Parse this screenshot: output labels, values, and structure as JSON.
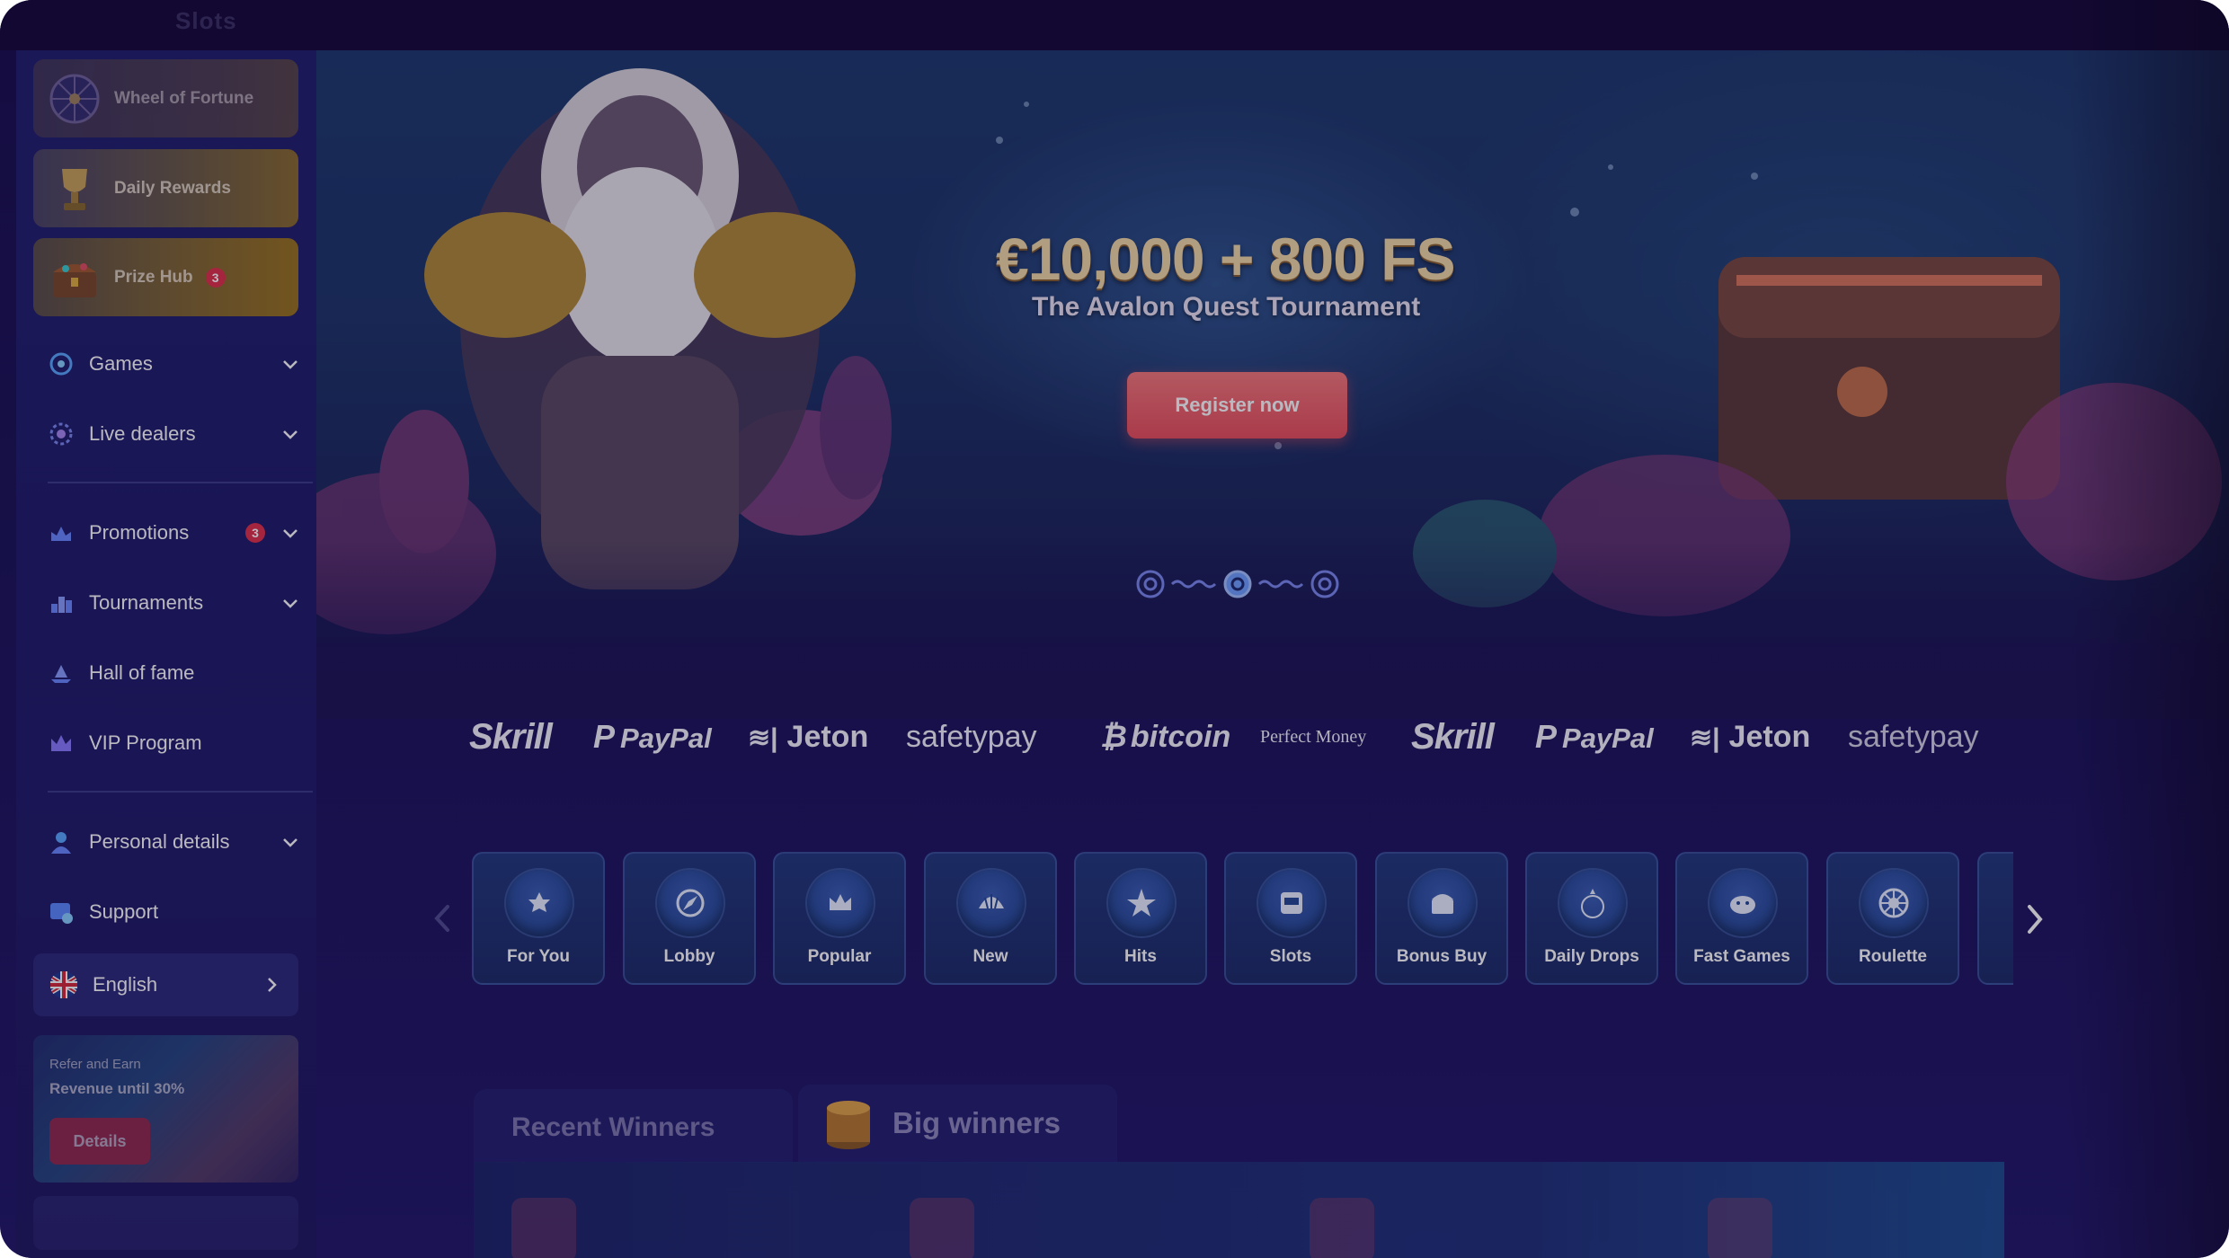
{
  "topbar": {
    "logo_text": "Slots"
  },
  "sidebar": {
    "promo_tiles": [
      {
        "label": "Wheel of Fortune",
        "icon": "wheel-icon"
      },
      {
        "label": "Daily Rewards",
        "icon": "trophy-icon"
      },
      {
        "label": "Prize Hub",
        "icon": "treasure-chest-icon",
        "badge": "3"
      }
    ],
    "nav": [
      {
        "label": "Games",
        "icon": "games-icon",
        "expandable": true
      },
      {
        "label": "Live dealers",
        "icon": "live-dealers-icon",
        "expandable": true
      },
      {
        "label": "Promotions",
        "icon": "promotions-icon",
        "expandable": true,
        "badge": "3"
      },
      {
        "label": "Tournaments",
        "icon": "tournaments-icon",
        "expandable": true
      },
      {
        "label": "Hall of fame",
        "icon": "hall-of-fame-icon",
        "expandable": false
      },
      {
        "label": "VIP Program",
        "icon": "crown-icon",
        "expandable": false
      },
      {
        "label": "Personal details",
        "icon": "user-icon",
        "expandable": true
      },
      {
        "label": "Support",
        "icon": "support-icon",
        "expandable": false
      }
    ],
    "language": {
      "label": "English",
      "icon": "uk-flag-icon"
    },
    "refer": {
      "small": "Refer and Earn",
      "big": "Revenue until 30%",
      "button": "Details"
    }
  },
  "hero": {
    "title": "€10,000 + 800 FS",
    "subtitle": "The Avalon Quest Tournament",
    "cta": "Register now"
  },
  "payments": [
    {
      "label": "Skrill",
      "style": "skrill"
    },
    {
      "label": "PayPal",
      "style": "paypal"
    },
    {
      "label": "Jeton",
      "style": "jeton"
    },
    {
      "label": "safetypay",
      "style": "safetypay"
    },
    {
      "label": "bitcoin",
      "style": "bitcoin"
    },
    {
      "label": "Perfect Money",
      "style": "perfectmoney"
    },
    {
      "label": "Skrill",
      "style": "skrill"
    },
    {
      "label": "PayPal",
      "style": "paypal"
    },
    {
      "label": "Jeton",
      "style": "jeton"
    },
    {
      "label": "safetypay",
      "style": "safetypay"
    }
  ],
  "categories": [
    {
      "label": "For You",
      "icon": "for-you-icon"
    },
    {
      "label": "Lobby",
      "icon": "lobby-compass-icon"
    },
    {
      "label": "Popular",
      "icon": "crown-icon"
    },
    {
      "label": "New",
      "icon": "shell-icon"
    },
    {
      "label": "Hits",
      "icon": "starfish-icon"
    },
    {
      "label": "Slots",
      "icon": "slot-machine-icon"
    },
    {
      "label": "Bonus Buy",
      "icon": "bonus-buy-icon"
    },
    {
      "label": "Daily Drops",
      "icon": "drops-wins-icon"
    },
    {
      "label": "Fast Games",
      "icon": "fast-games-icon"
    },
    {
      "label": "Roulette",
      "icon": "roulette-icon"
    }
  ],
  "winners": {
    "tab_recent": "Recent  Winners",
    "tab_big": "Big winners"
  },
  "colors": {
    "accent": "#e8505c",
    "badge": "#e0334a",
    "sidebar": "#22216f",
    "gold_title": "#f2d9a6"
  }
}
